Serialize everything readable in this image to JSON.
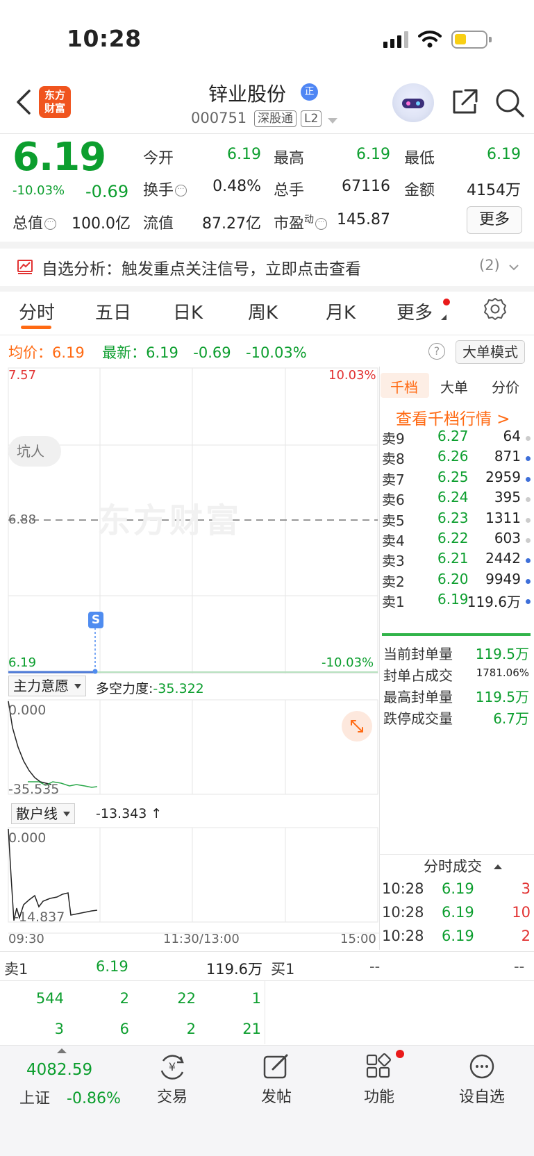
{
  "status_bar": {
    "time": "10:28"
  },
  "header": {
    "logo_line1": "东方",
    "logo_line2": "财富",
    "stock_name": "锌业股份",
    "badge": "正",
    "stock_code": "000751",
    "tag1": "深股通",
    "tag2": "L2"
  },
  "quote": {
    "price": "6.19",
    "change_pct": "-10.03%",
    "change": "-0.69",
    "open_label": "今开",
    "open": "6.19",
    "high_label": "最高",
    "high": "6.19",
    "low_label": "最低",
    "low": "6.19",
    "turnover_label": "换手",
    "turnover": "0.48%",
    "volume_label": "总手",
    "volume": "67116",
    "amount_label": "金额",
    "amount": "4154万",
    "mktcap_label": "总值",
    "mktcap": "100.0亿",
    "float_label": "流值",
    "float_cap": "87.27亿",
    "pe_label": "市盈",
    "pe_sup": "动",
    "pe": "145.87",
    "more_label": "更多"
  },
  "analysis": {
    "text": "自选分析：触发重点关注信号，立即点击查看",
    "count": "(2)"
  },
  "tabs": [
    "分时",
    "五日",
    "日K",
    "周K",
    "月K",
    "更多"
  ],
  "chart_header": {
    "avg_label": "均价：",
    "avg": "6.19",
    "latest_label": "最新：",
    "latest": "6.19",
    "latest_change": "-0.69",
    "latest_pct": "-10.03%",
    "help": "?",
    "big_order_mode": "大单模式"
  },
  "chart": {
    "watermark": "东方财富",
    "y_top": "7.57",
    "y_top_pct": "10.03%",
    "y_mid": "6.88",
    "y_bottom": "6.19",
    "y_bottom_pct": "-10.03%",
    "marker": "S",
    "tag": "坑人",
    "x_labels": [
      "09:30",
      "11:30/13:00",
      "15:00"
    ]
  },
  "chart_data": [
    {
      "type": "line",
      "title": "",
      "series": [
        {
          "values": [
            6.19,
            6.19
          ]
        }
      ],
      "x": [
        "09:30",
        "10:28"
      ],
      "ylim": [
        6.19,
        7.57
      ],
      "reference_line": 6.88
    },
    {
      "type": "line",
      "title": "主力意愿",
      "series": [
        {
          "name": "多空力度",
          "values": [
            0.0,
            -8,
            -16,
            -22,
            -27,
            -31,
            -33,
            -34,
            -35,
            -35.3
          ]
        }
      ],
      "ylim": [
        -35.535,
        0.0
      ]
    },
    {
      "type": "line",
      "title": "散户线",
      "series": [
        {
          "values": [
            0.0,
            -14.8,
            -11,
            -13,
            -8,
            -9,
            -5,
            -6,
            -3,
            -4.8,
            -14.8,
            -13.3
          ]
        }
      ],
      "ylim": [
        -14.837,
        0.0
      ]
    }
  ],
  "indicator1": {
    "name": "主力意愿",
    "label": "多空力度:",
    "value": "-35.322",
    "top": "0.000",
    "bottom": "-35.535"
  },
  "indicator2": {
    "name": "散户线",
    "value": "-13.343 ↑",
    "top": "0.000",
    "bottom": "-14.837"
  },
  "orderbook": {
    "tabs": [
      "千档",
      "大单",
      "分价"
    ],
    "link": "查看千档行情 >",
    "asks": [
      {
        "label": "卖9",
        "price": "6.27",
        "vol": "64",
        "dot": "#cccccc"
      },
      {
        "label": "卖8",
        "price": "6.26",
        "vol": "871",
        "dot": "#3e6fd9"
      },
      {
        "label": "卖7",
        "price": "6.25",
        "vol": "2959",
        "dot": "#3e6fd9"
      },
      {
        "label": "卖6",
        "price": "6.24",
        "vol": "395",
        "dot": "#cccccc"
      },
      {
        "label": "卖5",
        "price": "6.23",
        "vol": "1311",
        "dot": "#cccccc"
      },
      {
        "label": "卖4",
        "price": "6.22",
        "vol": "603",
        "dot": "#cccccc"
      },
      {
        "label": "卖3",
        "price": "6.21",
        "vol": "2442",
        "dot": "#3e6fd9"
      },
      {
        "label": "卖2",
        "price": "6.20",
        "vol": "9949",
        "dot": "#3e6fd9"
      },
      {
        "label": "卖1",
        "price": "6.19",
        "vol": "119.6万",
        "dot": "#3e6fd9"
      }
    ],
    "seal": [
      {
        "label": "当前封单量",
        "value": "119.5万"
      },
      {
        "label": "封单占成交",
        "value": "1781.06%"
      },
      {
        "label": "最高封单量",
        "value": "119.5万"
      },
      {
        "label": "跌停成交量",
        "value": "6.7万"
      }
    ]
  },
  "ticks": {
    "title": "分时成交",
    "rows": [
      {
        "time": "10:28",
        "price": "6.19",
        "vol": "3"
      },
      {
        "time": "10:28",
        "price": "6.19",
        "vol": "10"
      },
      {
        "time": "10:28",
        "price": "6.19",
        "vol": "2"
      }
    ]
  },
  "level1": {
    "sell_label": "卖1",
    "sell_price": "6.19",
    "sell_vol": "119.6万",
    "buy_label": "买1",
    "buy_price": "--",
    "buy_vol": "--",
    "queue_row1": [
      "544",
      "2",
      "22",
      "1"
    ],
    "queue_row2": [
      "3",
      "6",
      "2",
      "21"
    ]
  },
  "bottom_nav": {
    "index_value": "4082.59",
    "index_name": "上证",
    "index_pct": "-0.86%",
    "trade": "交易",
    "post": "发帖",
    "function": "功能",
    "watchlist": "设自选"
  },
  "colors": {
    "up": "#e23232",
    "down": "#0c9e2e",
    "accent": "#ff6a13",
    "blue": "#4f86f4"
  }
}
